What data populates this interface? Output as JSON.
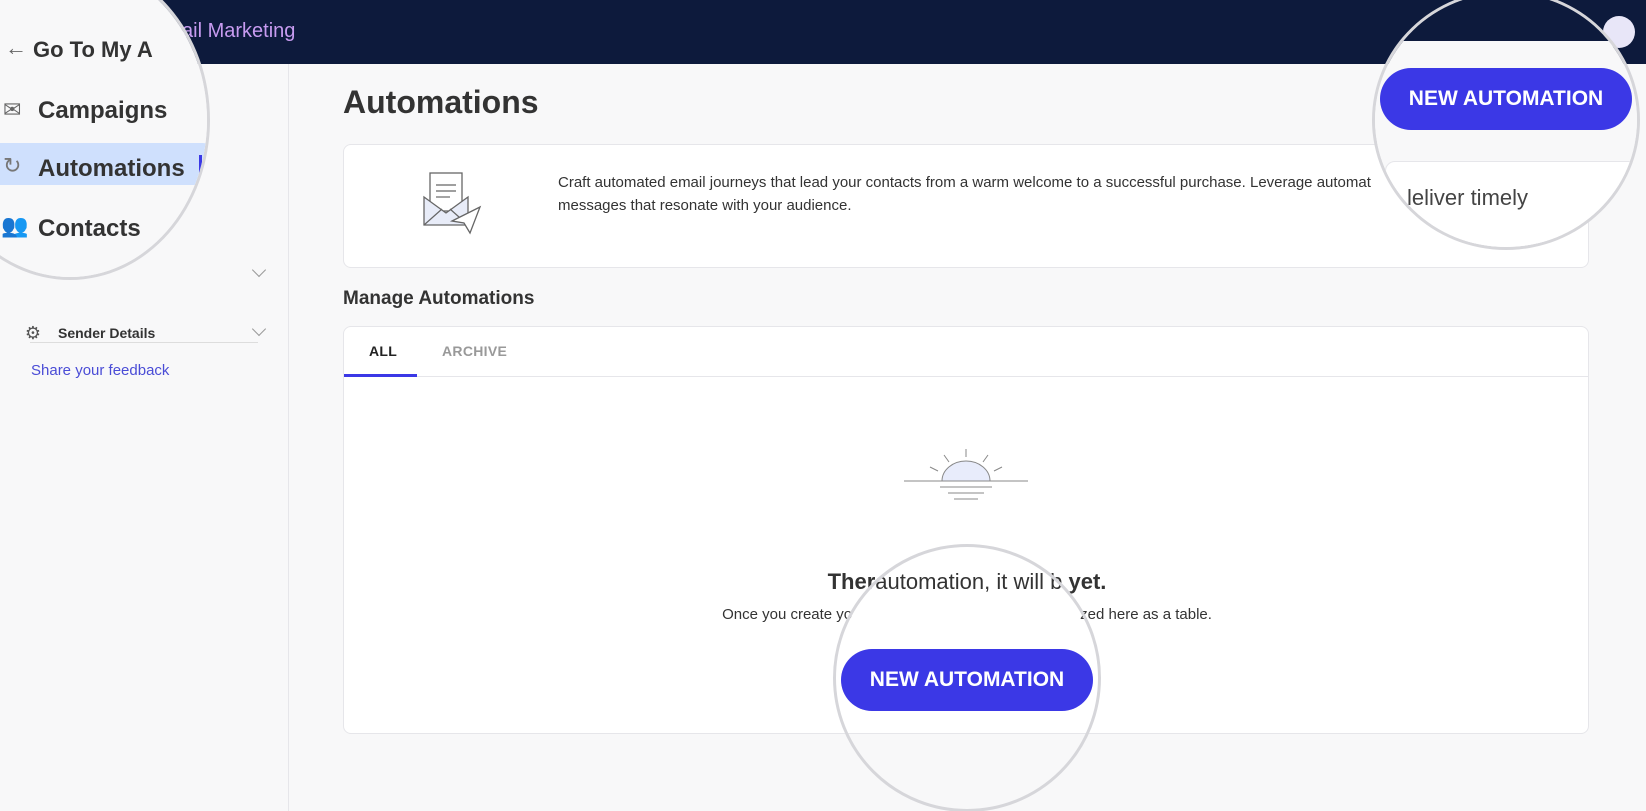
{
  "topbar": {
    "product_name": "Email Marketing"
  },
  "sidebar": {
    "back_label": "Go To My A",
    "items": [
      {
        "label": "Campaigns",
        "icon": "mail-icon"
      },
      {
        "label": "Automations",
        "icon": "sync-icon"
      },
      {
        "label": "Contacts",
        "icon": "users-icon"
      },
      {
        "label": "Sender Details",
        "icon": "gear-icon"
      }
    ],
    "feedback_label": "Share your feedback"
  },
  "main": {
    "title": "Automations",
    "new_button_label": "NEW AUTOMATION",
    "info": {
      "description": "Craft automated email journeys that lead your contacts from a warm welcome to a successful purchase. Leverage automat",
      "description_line2": "messages that resonate with your audience.",
      "magnified_tail": "leliver timely"
    },
    "section_title": "Manage Automations",
    "tabs": [
      {
        "label": "ALL"
      },
      {
        "label": "ARCHIVE"
      }
    ],
    "empty_state": {
      "title_left": "Ther",
      "title_middle": "automation, it will b",
      "title_right": "yet.",
      "subtitle_left": "Once you create yo",
      "subtitle_right": "zed here as a table.",
      "button_label": "NEW AUTOMATION"
    }
  },
  "colors": {
    "topbar": "#0d1a3c",
    "accent": "#3b38e6",
    "active_nav": "#cfe0fd",
    "product_name": "#c79bf0"
  }
}
